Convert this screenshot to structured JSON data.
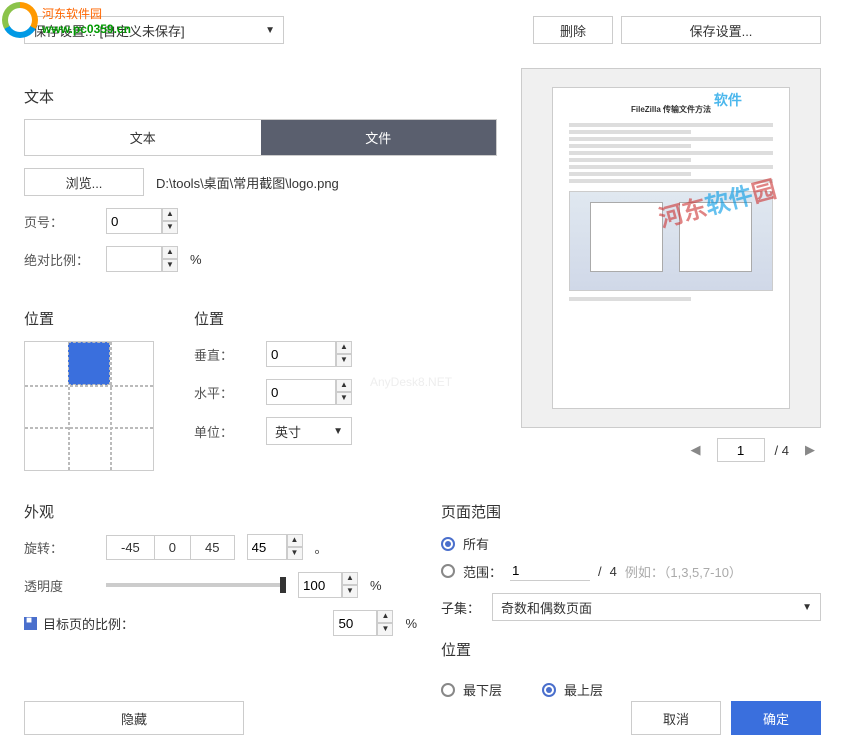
{
  "watermark": {
    "cn": "河东软件园",
    "url": "www.pc0359.cn"
  },
  "topbar": {
    "settings_combo": "保存设置... [自定义未保存]",
    "delete_btn": "删除",
    "save_settings_btn": "保存设置..."
  },
  "text_section": {
    "title": "文本",
    "tab_text": "文本",
    "tab_file": "文件",
    "browse_btn": "浏览...",
    "file_path": "D:\\tools\\桌面\\常用截图\\logo.png",
    "page_label": "页号：",
    "page_value": "0",
    "ratio_label": "绝对比例：",
    "ratio_value": "",
    "percent": "%"
  },
  "position": {
    "title": "位置",
    "title2": "位置",
    "vertical_label": "垂直：",
    "vertical_value": "0",
    "horizontal_label": "水平：",
    "horizontal_value": "0",
    "unit_label": "单位：",
    "unit_value": "英寸"
  },
  "preview": {
    "doc_title": "FileZilla 传输文件方法",
    "wm_text": "河东软件园",
    "pager_current": "1",
    "pager_total": "/ 4"
  },
  "appearance": {
    "title": "外观",
    "rotate_label": "旋转：",
    "rotate_neg45": "-45",
    "rotate_0": "0",
    "rotate_45": "45",
    "rotate_value": "45",
    "degree": "。",
    "opacity_label": "透明度",
    "opacity_value": "100",
    "percent": "%",
    "target_ratio_label": "目标页的比例：",
    "target_ratio_value": "50"
  },
  "page_range": {
    "title": "页面范围",
    "all_label": "所有",
    "range_label": "范围：",
    "range_from": "1",
    "range_sep": "/",
    "range_to": "4",
    "hint": "例如：（1,3,5,7-10）",
    "subset_label": "子集：",
    "subset_value": "奇数和偶数页面"
  },
  "layer": {
    "title": "位置",
    "bottom_label": "最下层",
    "top_label": "最上层"
  },
  "footer": {
    "hide_btn": "隐藏",
    "cancel_btn": "取消",
    "ok_btn": "确定"
  },
  "faint_wm": "AnyDesk8.NET"
}
